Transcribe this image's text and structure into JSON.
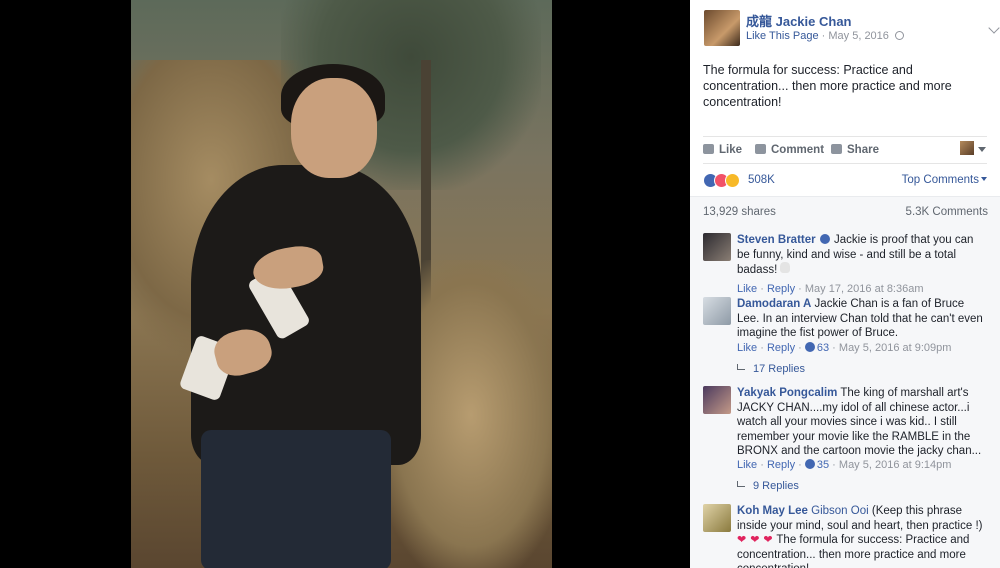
{
  "post": {
    "page_name": "成龍 Jackie Chan",
    "like_page": "Like This Page",
    "date": "May 5, 2016",
    "text": "The formula for success: Practice and concentration... then more practice and more concentration!"
  },
  "actions": {
    "like": "Like",
    "comment": "Comment",
    "share": "Share"
  },
  "reactions": {
    "count": "508K",
    "sort_label": "Top Comments"
  },
  "stats": {
    "shares": "13,929 shares",
    "comments": "5.3K Comments"
  },
  "comments": [
    {
      "name": "Steven Bratter",
      "text": "Jackie is proof that you can be funny, kind and wise - and still be a total badass!",
      "like": "Like",
      "reply": "Reply",
      "likes": "",
      "time": "May 17, 2016 at 8:36am",
      "replies": ""
    },
    {
      "name": "Damodaran A",
      "text": "Jackie Chan is a fan of Bruce Lee. In an interview Chan told that he can't even imagine the fist power of Bruce.",
      "like": "Like",
      "reply": "Reply",
      "likes": "63",
      "time": "May 5, 2016 at 9:09pm",
      "replies": "17 Replies"
    },
    {
      "name": "Yakyak Pongcalim",
      "text": "The king of marshall art's JACKY CHAN....my idol of all chinese actor...i watch all your movies since i was kid.. I still remember your movie like the RAMBLE in the BRONX and the cartoon movie the jacky chan...",
      "like": "Like",
      "reply": "Reply",
      "likes": "35",
      "time": "May 5, 2016 at 9:14pm",
      "replies": "9 Replies"
    },
    {
      "name": "Koh May Lee",
      "tag": "Gibson Ooi",
      "text_a": "(Keep this phrase inside your mind, soul and heart, then practice !)",
      "text_b": "The formula for success: Practice and concentration... then more practice and more concentration!"
    }
  ],
  "colors": {
    "link": "#365899",
    "like_blue": "#4267b2",
    "love_red": "#f25268",
    "haha_yellow": "#f7b928"
  }
}
